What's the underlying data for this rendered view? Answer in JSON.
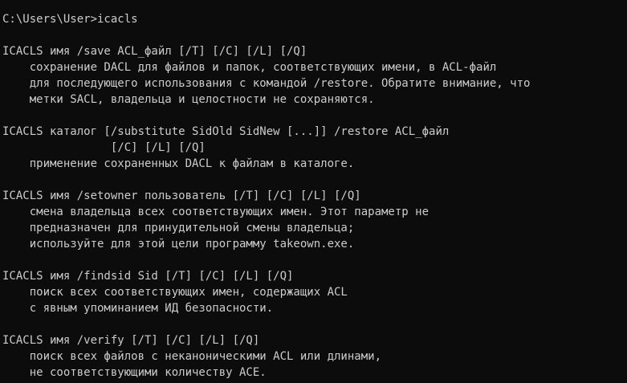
{
  "console": {
    "lines": [
      "C:\\Users\\User>icacls",
      "",
      "ICACLS имя /save ACL_файл [/T] [/C] [/L] [/Q]",
      "    сохранение DACL для файлов и папок, соответствующих имени, в ACL-файл",
      "    для последующего использования с командой /restore. Обратите внимание, что",
      "    метки SACL, владельца и целостности не сохраняются.",
      "",
      "ICACLS каталог [/substitute SidOld SidNew [...]] /restore ACL_файл",
      "                [/C] [/L] [/Q]",
      "    применение сохраненных DACL к файлам в каталоге.",
      "",
      "ICACLS имя /setowner пользователь [/T] [/C] [/L] [/Q]",
      "    смена владельца всех соответствующих имен. Этот параметр не",
      "    предназначен для принудительной смены владельца;",
      "    используйте для этой цели программу takeown.exe.",
      "",
      "ICACLS имя /findsid Sid [/T] [/C] [/L] [/Q]",
      "    поиск всех соответствующих имен, содержащих ACL",
      "    с явным упоминанием ИД безопасности.",
      "",
      "ICACLS имя /verify [/T] [/C] [/L] [/Q]",
      "    поиск всех файлов с неканоническими ACL или длинами,",
      "    не соответствующими количеству ACE."
    ]
  },
  "colors": {
    "background": "#0c0c0c",
    "text": "#cccccc"
  }
}
